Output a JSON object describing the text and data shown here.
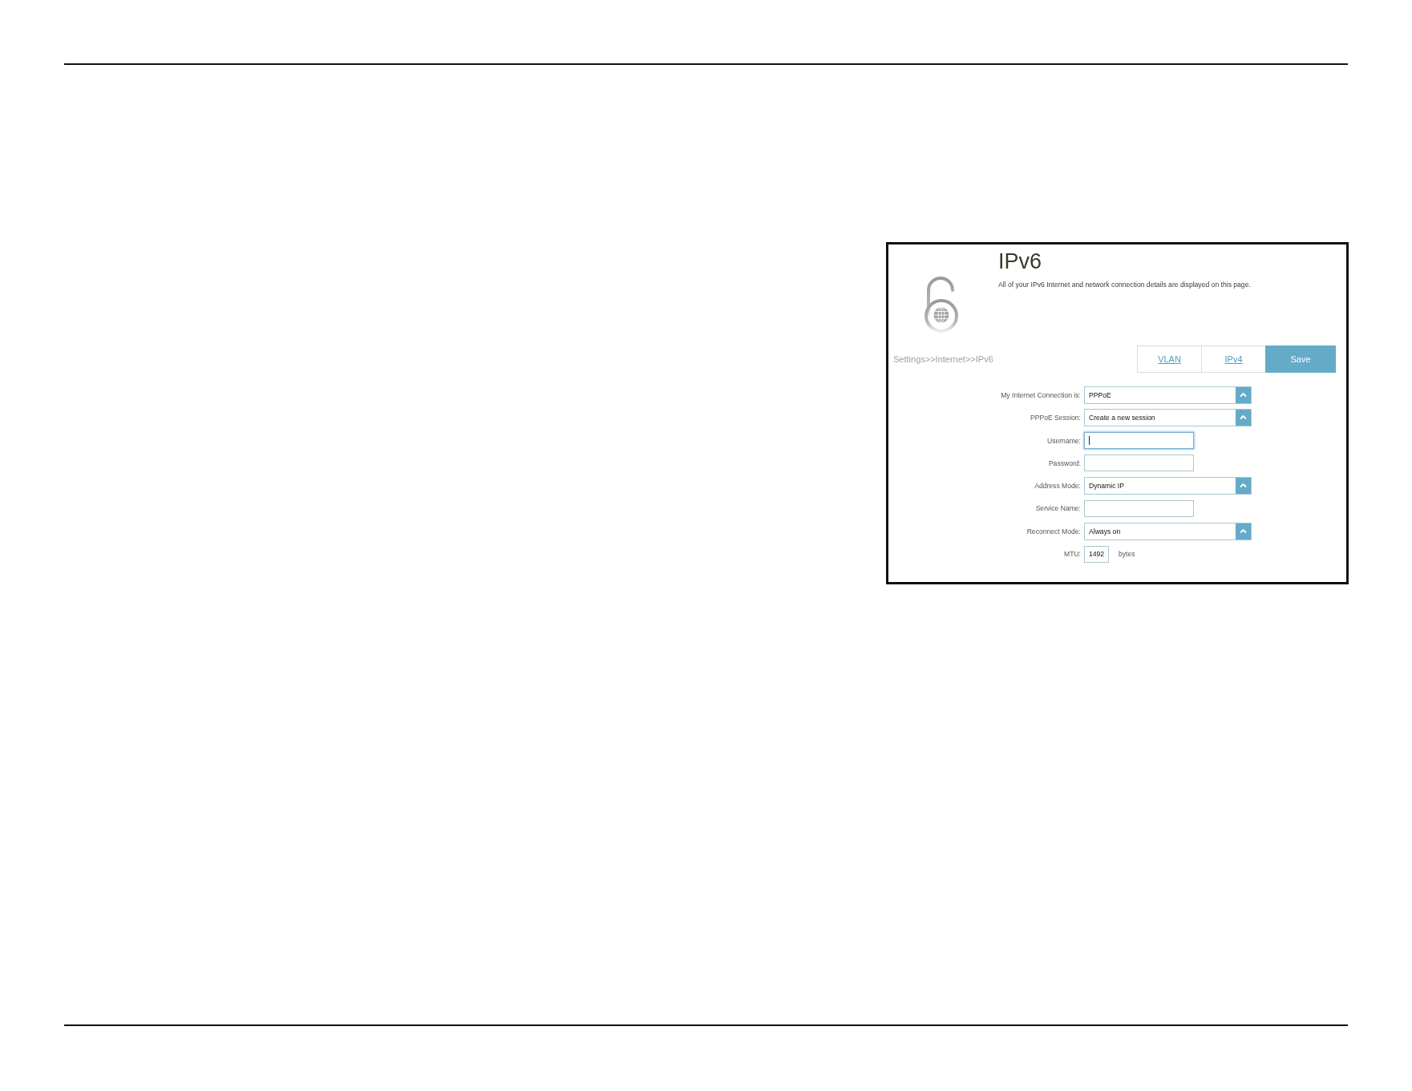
{
  "panel": {
    "title": "IPv6",
    "description": "All of your IPv6 Internet and network connection details are displayed on this page.",
    "breadcrumb": "Settings>>Internet>>IPv6",
    "buttons": [
      {
        "label": "VLAN",
        "kind": "link"
      },
      {
        "label": "IPv4",
        "kind": "link"
      },
      {
        "label": "Save",
        "kind": "primary"
      }
    ],
    "fields": [
      {
        "label": "My Internet Connection is:",
        "kind": "select",
        "value": "PPPoE",
        "focused": false
      },
      {
        "label": "PPPoE Session:",
        "kind": "select",
        "value": "Create a new session",
        "focused": false
      },
      {
        "label": "Username:",
        "kind": "text",
        "focused": true
      },
      {
        "label": "Password:",
        "kind": "text",
        "focused": false
      },
      {
        "label": "Address Mode:",
        "kind": "select",
        "value": "Dynamic IP",
        "focused": false
      },
      {
        "label": "Service Name:",
        "kind": "text",
        "focused": false
      },
      {
        "label": "Reconnect Mode:",
        "kind": "select",
        "value": "Always on",
        "focused": false
      },
      {
        "label": "MTU:",
        "kind": "short",
        "value": "1492",
        "unit": "bytes",
        "focused": false
      }
    ]
  }
}
